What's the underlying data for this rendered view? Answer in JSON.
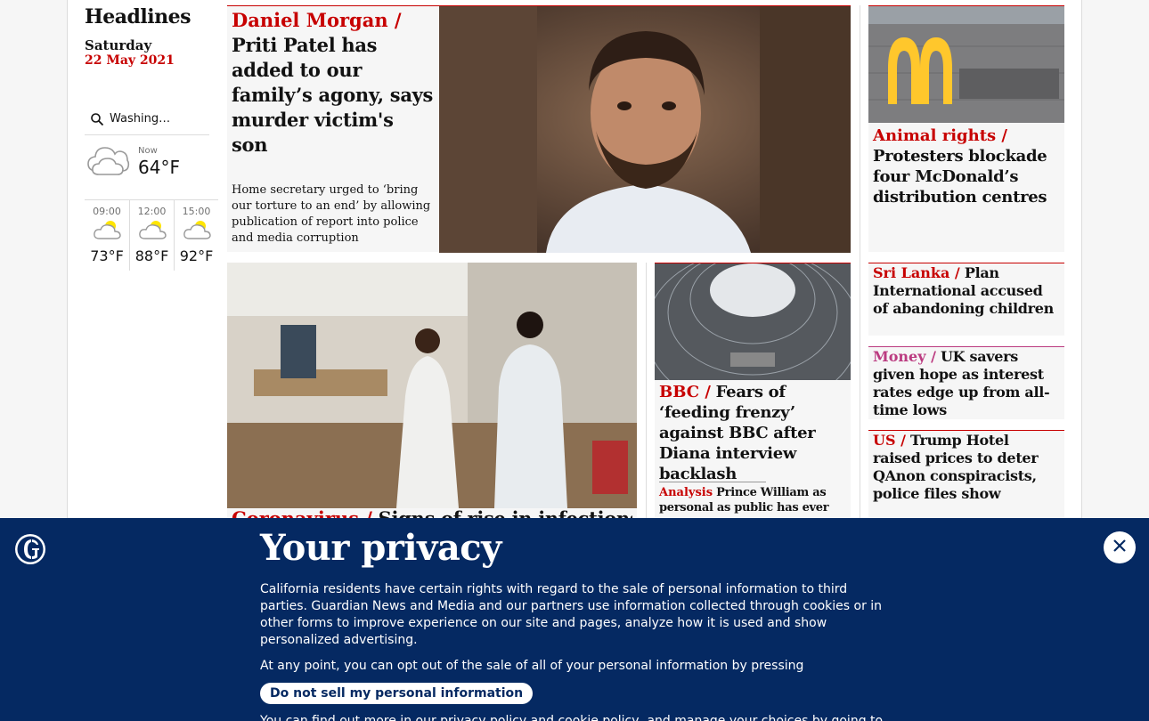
{
  "sidebar": {
    "section_title": "Headlines",
    "day": "Saturday",
    "date": "22 May 2021",
    "weather": {
      "location": "Washing…",
      "now_label": "Now",
      "now_temp": "64°F",
      "forecast": [
        {
          "time": "09:00",
          "temp": "73°F"
        },
        {
          "time": "12:00",
          "temp": "88°F"
        },
        {
          "time": "15:00",
          "temp": "92°F"
        }
      ]
    }
  },
  "stories": {
    "main": {
      "kicker": "Daniel Morgan /",
      "headline": "Priti Patel has added to our family’s agony, says murder victim's son",
      "standfirst": "Home secretary urged to ‘bring our torture to an end’ by allowing publication of report into police and media corruption"
    },
    "mcdonalds": {
      "kicker": "Animal rights  /",
      "headline": "Protesters blockade four McDonald’s distribution centres"
    },
    "covid": {
      "kicker": "Coronavirus /",
      "headline": "Signs of rise in infections"
    },
    "bbc": {
      "kicker": "BBC /",
      "headline": "Fears of ‘feeding frenzy’ against BBC after Diana interview backlash",
      "analysis_kicker": "Analysis",
      "analysis_text": "Prince William as personal as public has ever seen"
    },
    "srilanka": {
      "kicker": "Sri Lanka /",
      "headline": "Plan International accused of abandoning children"
    },
    "money": {
      "kicker": "Money /",
      "headline": "UK savers given hope as interest rates edge up from all-time lows"
    },
    "us": {
      "kicker": "US /",
      "headline": "Trump Hotel raised prices to deter QAnon conspiracists, police files show"
    }
  },
  "privacy": {
    "title": "Your privacy",
    "body": "California residents have certain rights with regard to the sale of personal information to third parties. Guardian News and Media and our partners use information collected through cookies or in other forms to improve experience on our site and pages, analyze how it is used and show personalized advertising.",
    "body2": "At any point, you can opt out of the sale of all of your personal information by pressing",
    "button": "Do not sell my personal information",
    "body3": "You can find out more in our privacy policy and cookie policy, and manage your choices by going to"
  },
  "colors": {
    "brand_blue": "#052962",
    "news_red": "#c70000",
    "lifestyle_pink": "#bb3b80"
  }
}
